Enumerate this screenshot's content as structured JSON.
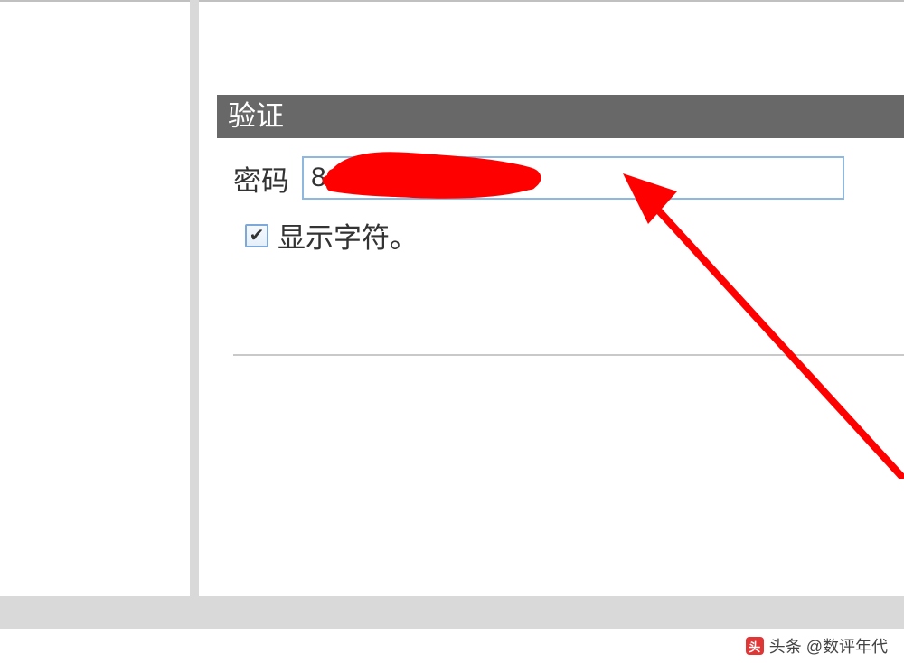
{
  "section": {
    "title": "验证"
  },
  "form": {
    "password_label": "密码",
    "password_value": "8",
    "show_chars_label": "显示字符。",
    "show_chars_checked": true
  },
  "watermark": {
    "text": "头条 @数评年代"
  }
}
